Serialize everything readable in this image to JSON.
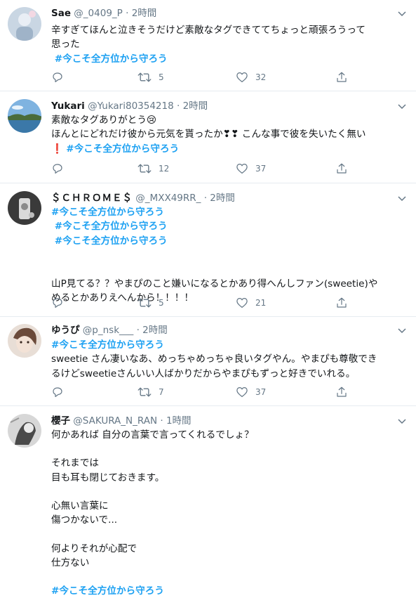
{
  "hashtag": "#今こそ全方位から守ろう",
  "tweets": [
    {
      "name": "Sae",
      "handle": "@_0409_P",
      "dot": "·",
      "time": "2時間",
      "text": "辛すぎてほんと泣きそうだけど素敵なタグできててちょっと頑張ろうって\n思った",
      "hashtag_line": " #今こそ全方位から守ろう",
      "retweets": "5",
      "likes": "32"
    },
    {
      "name": "Yukari",
      "handle": "@Yukari80354218",
      "dot": "·",
      "time": "2時間",
      "text_line1": "素敵なタグありがとう😢",
      "text_line2": "ほんとにどれだけ彼から元気を貰ったか❣❣ こんな事で彼を失いたく無い",
      "text_line3_prefix": "❗ ",
      "hashtag_line": "#今こそ全方位から守ろう",
      "retweets": "12",
      "likes": "37"
    },
    {
      "name": "＄ＣＨＲＯＭＥ＄",
      "handle": "@_MXX49RR_",
      "dot": "·",
      "time": "2時間",
      "hashtag_1": "#今こそ全方位から守ろう",
      "hashtag_2": " #今こそ全方位から守ろう",
      "hashtag_3": " #今こそ全方位から守ろう",
      "text": "山P見てる？？やまぴのこと嫌いになるとかあり得へんしファン(sweetie)や\nめるとかありえへんから！！！！",
      "retweets": "5",
      "likes": "21"
    },
    {
      "name": "ゆうぴ",
      "handle": "@p_nsk___",
      "dot": "·",
      "time": "2時間",
      "hashtag_line": "#今こそ全方位から守ろう",
      "text": "sweetie さん凄いなあ、めっちゃめっちゃ良いタグやん。やまぴも尊敬でき\nるけどsweetieさんいい人ばかりだからやまぴもずっと好きでいれる。",
      "retweets": "7",
      "likes": "37"
    },
    {
      "name": "櫻子",
      "handle": "@SAKURA_N_RAN",
      "dot": "·",
      "time": "1時間",
      "text": "何かあれば 自分の言葉で言ってくれるでしょ？\n\nそれまでは\n目も耳も閉じておきます。\n\n心無い言葉に\n傷つかないで...\n\n何よりそれが心配で\n仕方ない\n",
      "hashtag_line": "#今こそ全方位から守ろう"
    }
  ],
  "icons": {
    "reply": "reply-icon",
    "retweet": "retweet-icon",
    "like": "heart-icon",
    "share": "share-icon",
    "caret": "chevron-down-icon"
  },
  "colors": {
    "hashtag": "#1da1f2",
    "secondary": "#657786",
    "divider": "#e6ecf0",
    "heart_red": "#e0245e"
  }
}
